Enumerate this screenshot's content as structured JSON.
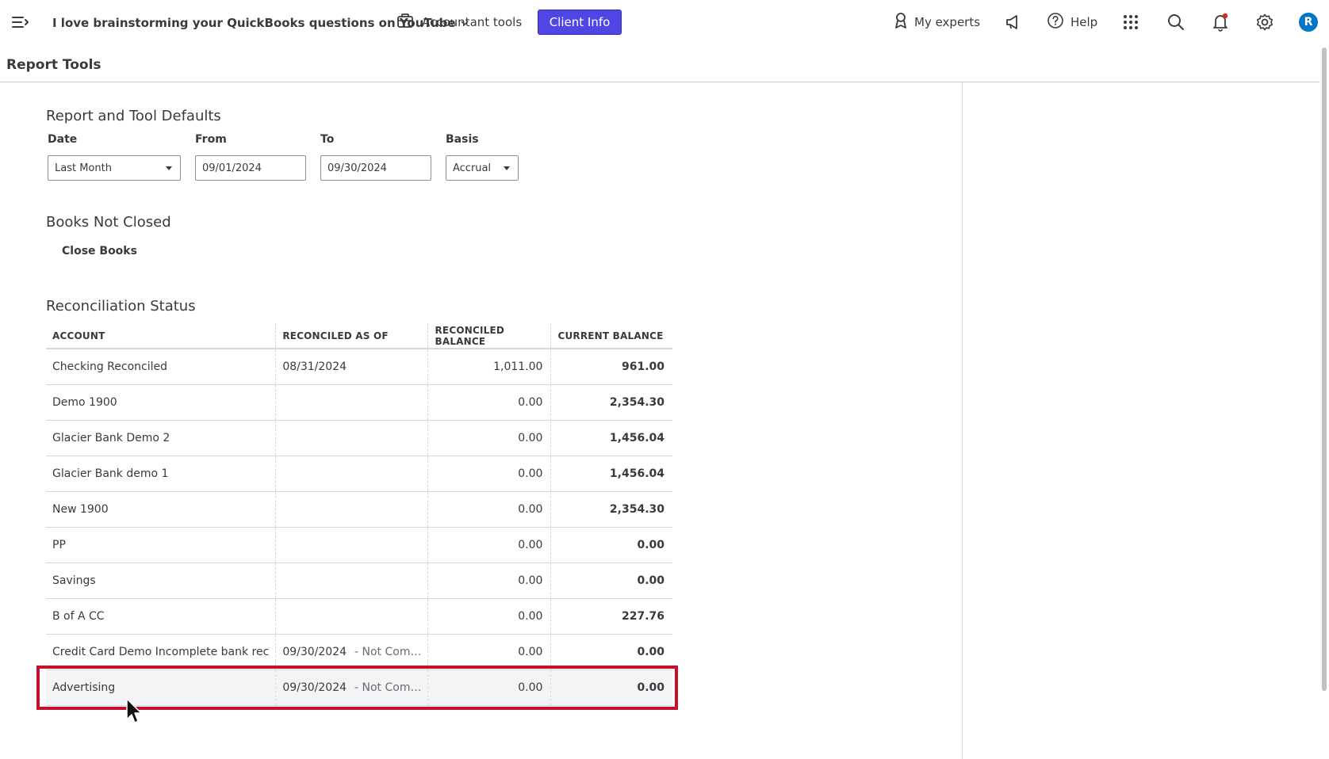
{
  "topbar": {
    "company_name": "I love brainstorming your QuickBooks questions on YouTube",
    "accountant_tools": "Accountant tools",
    "client_info": "Client Info",
    "my_experts": "My experts",
    "help": "Help",
    "avatar_initial": "R"
  },
  "page": {
    "title": "Report Tools"
  },
  "defaults": {
    "heading": "Report and Tool Defaults",
    "date_label": "Date",
    "date_value": "Last Month",
    "from_label": "From",
    "from_value": "09/01/2024",
    "to_label": "To",
    "to_value": "09/30/2024",
    "basis_label": "Basis",
    "basis_value": "Accrual"
  },
  "books": {
    "heading": "Books Not Closed",
    "close_books": "Close Books"
  },
  "reconciliation": {
    "heading": "Reconciliation Status",
    "columns": [
      "ACCOUNT",
      "RECONCILED AS OF",
      "RECONCILED BALANCE",
      "CURRENT BALANCE"
    ],
    "rows": [
      {
        "account": "Checking Reconciled",
        "as_of": "08/31/2024",
        "note": "",
        "reconciled_balance": "1,011.00",
        "current_balance": "961.00"
      },
      {
        "account": "Demo 1900",
        "as_of": "",
        "note": "",
        "reconciled_balance": "0.00",
        "current_balance": "2,354.30"
      },
      {
        "account": "Glacier Bank Demo 2",
        "as_of": "",
        "note": "",
        "reconciled_balance": "0.00",
        "current_balance": "1,456.04"
      },
      {
        "account": "Glacier Bank demo 1",
        "as_of": "",
        "note": "",
        "reconciled_balance": "0.00",
        "current_balance": "1,456.04"
      },
      {
        "account": "New 1900",
        "as_of": "",
        "note": "",
        "reconciled_balance": "0.00",
        "current_balance": "2,354.30"
      },
      {
        "account": "PP",
        "as_of": "",
        "note": "",
        "reconciled_balance": "0.00",
        "current_balance": "0.00"
      },
      {
        "account": "Savings",
        "as_of": "",
        "note": "",
        "reconciled_balance": "0.00",
        "current_balance": "0.00"
      },
      {
        "account": "B of A CC",
        "as_of": "",
        "note": "",
        "reconciled_balance": "0.00",
        "current_balance": "227.76"
      },
      {
        "account": "Credit Card Demo Incomplete bank rec",
        "as_of": "09/30/2024",
        "note": "- Not Com…",
        "reconciled_balance": "0.00",
        "current_balance": "0.00"
      },
      {
        "account": "Advertising",
        "as_of": "09/30/2024",
        "note": "- Not Com…",
        "reconciled_balance": "0.00",
        "current_balance": "0.00"
      }
    ]
  },
  "colors": {
    "client_info_bg": "#4f46e5",
    "highlight_border": "#c8102e",
    "avatar_bg": "#0077c5"
  }
}
